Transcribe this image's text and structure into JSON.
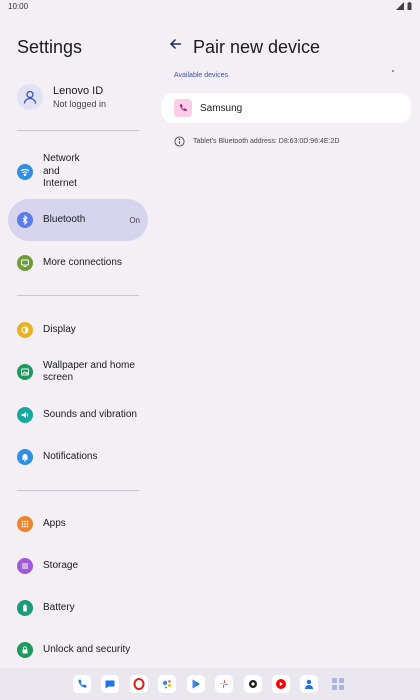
{
  "status_bar": {
    "time": "10:00"
  },
  "settings": {
    "title": "Settings",
    "account": {
      "name": "Lenovo ID",
      "status": "Not logged in"
    },
    "groups": [
      [
        {
          "label": "Network and Internet",
          "icon": "wifi-icon",
          "color": "#2f8fe0"
        },
        {
          "label": "Bluetooth",
          "state": "On",
          "icon": "bluetooth-icon",
          "color": "#5b7be8",
          "active": true
        },
        {
          "label": "More connections",
          "icon": "connections-icon",
          "color": "#6e9c3a"
        }
      ],
      [
        {
          "label": "Display",
          "icon": "brightness-icon",
          "color": "#e8b320"
        },
        {
          "label": "Wallpaper and home screen",
          "icon": "wallpaper-icon",
          "color": "#1e9a5c"
        },
        {
          "label": "Sounds and vibration",
          "icon": "volume-icon",
          "color": "#18a8a0"
        },
        {
          "label": "Notifications",
          "icon": "bell-icon",
          "color": "#2f8fe0"
        }
      ],
      [
        {
          "label": "Apps",
          "icon": "apps-grid-icon",
          "color": "#f0842a"
        },
        {
          "label": "Storage",
          "icon": "storage-icon",
          "color": "#a25ad6"
        },
        {
          "label": "Battery",
          "icon": "battery-icon",
          "color": "#1e9a7a"
        },
        {
          "label": "Unlock and security",
          "icon": "lock-icon",
          "color": "#1e9a5c"
        }
      ]
    ]
  },
  "pair": {
    "title": "Pair new device",
    "section": "Available devices",
    "devices": [
      {
        "name": "Samsung",
        "icon": "phone-icon"
      }
    ],
    "address_text": "Tablet's Bluetooth address: D8:63:0D:96:4E:2D"
  },
  "dock": {
    "apps": [
      {
        "name": "phone-app-icon",
        "bg": "#ffffff",
        "fg": "#1a73e8"
      },
      {
        "name": "messages-app-icon",
        "bg": "#ffffff",
        "fg": "#1a73e8"
      },
      {
        "name": "opera-app-icon",
        "bg": "#ffffff",
        "fg": "#e0201b"
      },
      {
        "name": "assistant-app-icon",
        "bg": "#ffffff",
        "fg": "#4285f4"
      },
      {
        "name": "play-store-app-icon",
        "bg": "#ffffff",
        "fg": "#01875f"
      },
      {
        "name": "photos-app-icon",
        "bg": "#ffffff",
        "fg": "#fbbc04"
      },
      {
        "name": "settings-app-icon",
        "bg": "#ffffff",
        "fg": "#222222"
      },
      {
        "name": "youtube-music-app-icon",
        "bg": "#ffffff",
        "fg": "#ff0000"
      },
      {
        "name": "contacts-app-icon",
        "bg": "#ffffff",
        "fg": "#1a73e8"
      },
      {
        "name": "app-drawer-icon",
        "bg": "#ebe7ee",
        "fg": "#a9b4e3"
      }
    ]
  },
  "colors": {
    "accent": "#3f51b5",
    "active_bg": "#d7d5ee"
  }
}
